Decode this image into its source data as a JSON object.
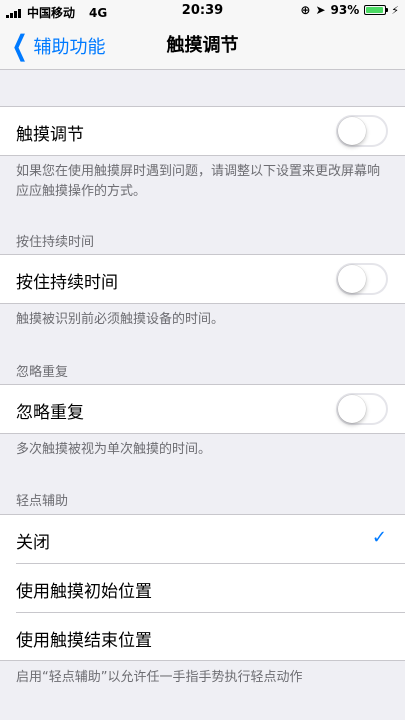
{
  "status": {
    "carrier": "中国移动",
    "network": "4G",
    "time": "20:39",
    "battery": "93%",
    "battery_level": 0.93
  },
  "nav": {
    "back_label": "辅助功能",
    "title": "触摸调节"
  },
  "touch_accommodations": {
    "label": "触摸调节",
    "on": false,
    "footer": "如果您在使用触摸屏时遇到问题，请调整以下设置来更改屏幕响应应触摸操作的方式。"
  },
  "hold_duration": {
    "header": "按住持续时间",
    "label": "按住持续时间",
    "on": false,
    "footer": "触摸被识别前必须触摸设备的时间。"
  },
  "ignore_repeat": {
    "header": "忽略重复",
    "label": "忽略重复",
    "on": false,
    "footer": "多次触摸被视为单次触摸的时间。"
  },
  "tap_assistance": {
    "header": "轻点辅助",
    "options": [
      "关闭",
      "使用触摸初始位置",
      "使用触摸结束位置"
    ],
    "selected": 0,
    "footer": "启用“轻点辅助”以允许任一手指手势执行轻点动作"
  },
  "colors": {
    "accent": "#007aff",
    "background": "#efeff4",
    "battery": "#4cd964"
  }
}
